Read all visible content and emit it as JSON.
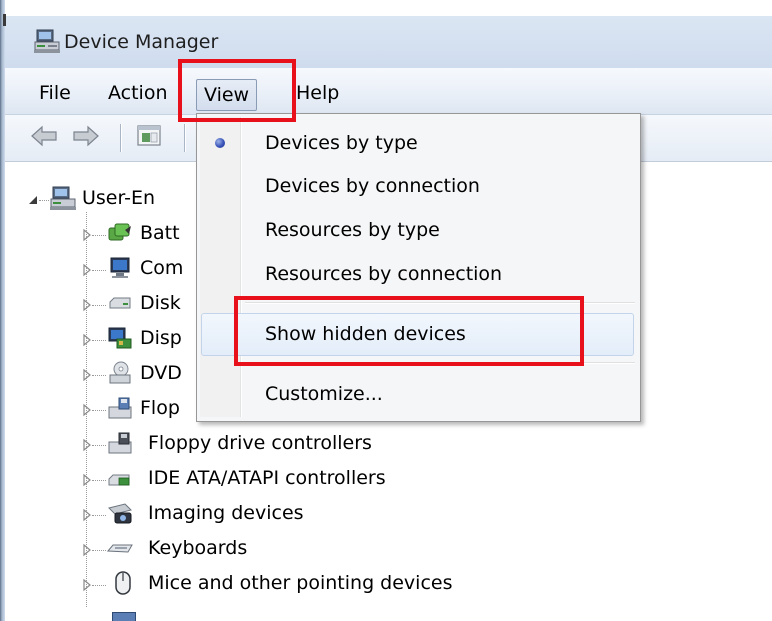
{
  "window": {
    "title": "Device Manager"
  },
  "menubar": {
    "items": [
      {
        "label": "File"
      },
      {
        "label": "Action"
      },
      {
        "label": "View"
      },
      {
        "label": "Help"
      }
    ],
    "active": "View"
  },
  "toolbar": {
    "buttons": [
      {
        "icon": "back-arrow-icon"
      },
      {
        "icon": "forward-arrow-icon"
      },
      {
        "icon": "properties-icon"
      }
    ]
  },
  "view_menu": {
    "items": [
      {
        "label": "Devices by type",
        "checked": true
      },
      {
        "label": "Devices by connection",
        "checked": false
      },
      {
        "label": "Resources by type",
        "checked": false
      },
      {
        "label": "Resources by connection",
        "checked": false
      },
      {
        "label": "Show hidden devices",
        "checked": false,
        "highlighted": true
      },
      {
        "label": "Customize...",
        "checked": false
      }
    ]
  },
  "tree": {
    "root": {
      "label": "User-En",
      "icon": "computer-icon",
      "expanded": true
    },
    "nodes": [
      {
        "label": "Batt",
        "icon": "battery-icon"
      },
      {
        "label": "Com",
        "icon": "computer-icon"
      },
      {
        "label": "Disk",
        "icon": "disk-drive-icon"
      },
      {
        "label": "Disp",
        "icon": "display-adapter-icon"
      },
      {
        "label": "DVD",
        "icon": "dvd-drive-icon"
      },
      {
        "label": "Flop",
        "icon": "floppy-disk-icon"
      },
      {
        "label": "Floppy drive controllers",
        "icon": "floppy-controller-icon"
      },
      {
        "label": "IDE ATA/ATAPI controllers",
        "icon": "ide-controller-icon"
      },
      {
        "label": "Imaging devices",
        "icon": "camera-icon"
      },
      {
        "label": "Keyboards",
        "icon": "keyboard-icon"
      },
      {
        "label": "Mice and other pointing devices",
        "icon": "mouse-icon"
      }
    ]
  },
  "annotations": {
    "color": "#e8101a",
    "highlights": [
      "View",
      "Show hidden devices"
    ]
  }
}
